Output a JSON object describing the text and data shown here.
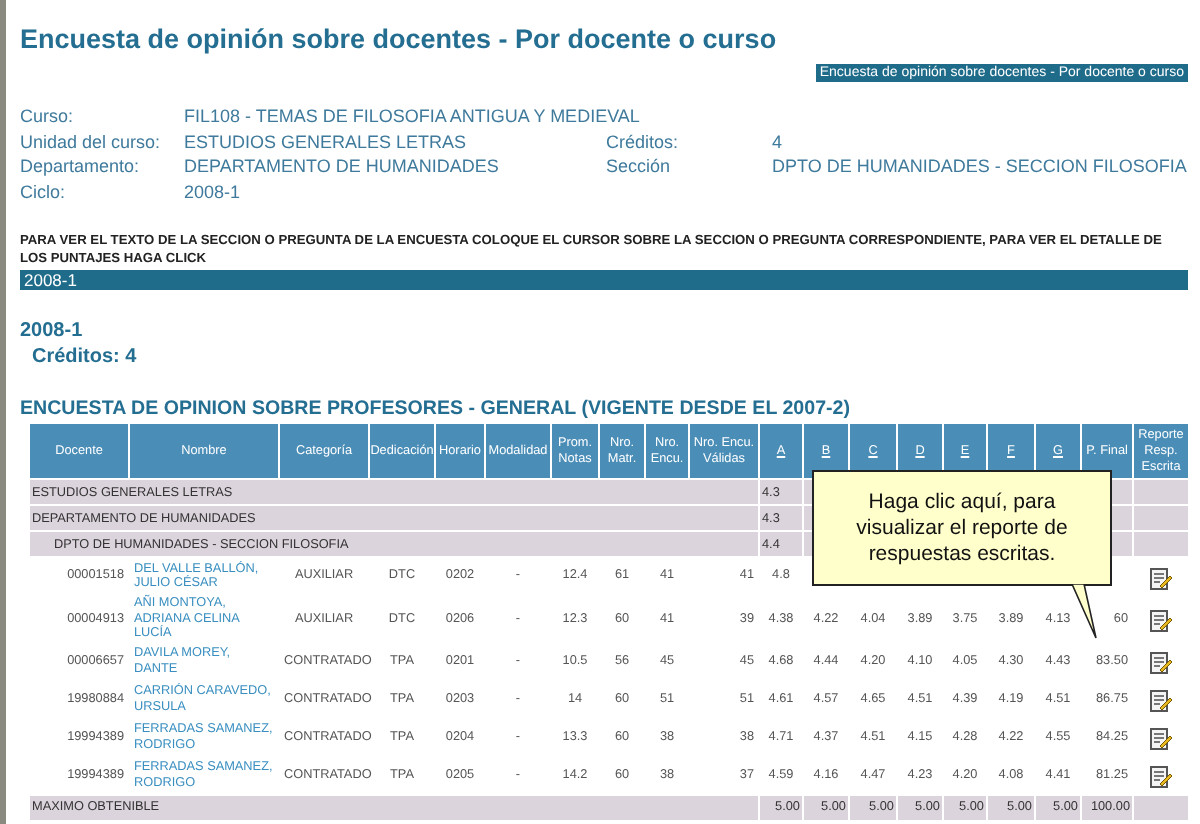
{
  "title": "Encuesta de opinión sobre docentes - Por docente o curso",
  "banner": "Encuesta de opinión sobre docentes - Por docente o curso",
  "info": [
    {
      "label": "Curso:",
      "value": "FIL108 - TEMAS DE FILOSOFIA ANTIGUA Y MEDIEVAL"
    },
    {
      "label": "Unidad del curso:",
      "value": "ESTUDIOS GENERALES LETRAS",
      "label2": "Créditos:",
      "value2": "4"
    },
    {
      "label": "Departamento:",
      "value": "DEPARTAMENTO DE HUMANIDADES",
      "label2": "Sección",
      "value2": "DPTO DE HUMANIDADES - SECCION FILOSOFIA"
    },
    {
      "label": "Ciclo:",
      "value": "2008-1"
    }
  ],
  "instructions": "PARA VER EL TEXTO DE LA SECCION O PREGUNTA DE LA ENCUESTA COLOQUE EL CURSOR SOBRE LA SECCION O PREGUNTA CORRESPONDIENTE, PARA VER EL DETALLE DE LOS PUNTAJES HAGA CLICK",
  "period_bar": "2008-1",
  "period": "2008-1",
  "credits": "Créditos: 4",
  "survey_title": "ENCUESTA DE OPINION SOBRE PROFESORES - GENERAL (VIGENTE DESDE EL 2007-2)",
  "table": {
    "columns": [
      {
        "label": "Docente",
        "link": false
      },
      {
        "label": "Nombre",
        "link": false
      },
      {
        "label": "Categoría",
        "link": false
      },
      {
        "label": "Dedicación",
        "link": false
      },
      {
        "label": "Horario",
        "link": false
      },
      {
        "label": "Modalidad",
        "link": false
      },
      {
        "label": "Prom. Notas",
        "link": false
      },
      {
        "label": "Nro. Matr.",
        "link": false
      },
      {
        "label": "Nro. Encu.",
        "link": false
      },
      {
        "label": "Nro. Encu. Válidas",
        "link": false
      },
      {
        "label": "A",
        "link": true
      },
      {
        "label": "B",
        "link": true
      },
      {
        "label": "C",
        "link": true
      },
      {
        "label": "D",
        "link": true
      },
      {
        "label": "E",
        "link": true
      },
      {
        "label": "F",
        "link": true
      },
      {
        "label": "G",
        "link": true
      },
      {
        "label": "P. Final",
        "link": false
      },
      {
        "label": "Reporte Resp. Escrita",
        "link": false
      }
    ],
    "group_rows": [
      {
        "kind": "unit",
        "label": "ESTUDIOS GENERALES LETRAS",
        "a": "4.3"
      },
      {
        "kind": "unit",
        "label": "DEPARTAMENTO DE HUMANIDADES",
        "a": "4.3"
      },
      {
        "kind": "section",
        "label": "DPTO DE HUMANIDADES - SECCION FILOSOFIA",
        "a": "4.4"
      }
    ],
    "rows": [
      {
        "docente": "00001518",
        "nombre": "DEL VALLE BALLÓN, JULIO CÉSAR",
        "categoria": "AUXILIAR",
        "dedicacion": "DTC",
        "horario": "0202",
        "modalidad": "-",
        "prom": "12.4",
        "matr": "61",
        "encu": "41",
        "validas": "41",
        "scores": [
          "4.8"
        ]
      },
      {
        "docente": "00004913",
        "nombre": "AÑI MONTOYA, ADRIANA CELINA LUCÍA",
        "categoria": "AUXILIAR",
        "dedicacion": "DTC",
        "horario": "0206",
        "modalidad": "-",
        "prom": "12.3",
        "matr": "60",
        "encu": "41",
        "validas": "39",
        "scores": [
          "4.38",
          "4.22",
          "4.04",
          "3.89",
          "3.75",
          "3.89",
          "4.13"
        ],
        "final": "60"
      },
      {
        "docente": "00006657",
        "nombre": "DAVILA MOREY, DANTE",
        "categoria": "CONTRATADO",
        "dedicacion": "TPA",
        "horario": "0201",
        "modalidad": "-",
        "prom": "10.5",
        "matr": "56",
        "encu": "45",
        "validas": "45",
        "scores": [
          "4.68",
          "4.44",
          "4.20",
          "4.10",
          "4.05",
          "4.30",
          "4.43"
        ],
        "final": "83.50"
      },
      {
        "docente": "19980884",
        "nombre": "CARRIÓN CARAVEDO, URSULA",
        "categoria": "CONTRATADO",
        "dedicacion": "TPA",
        "horario": "0203",
        "modalidad": "-",
        "prom": "14",
        "matr": "60",
        "encu": "51",
        "validas": "51",
        "scores": [
          "4.61",
          "4.57",
          "4.65",
          "4.51",
          "4.39",
          "4.19",
          "4.51"
        ],
        "final": "86.75"
      },
      {
        "docente": "19994389",
        "nombre": "FERRADAS SAMANEZ, RODRIGO",
        "categoria": "CONTRATADO",
        "dedicacion": "TPA",
        "horario": "0204",
        "modalidad": "-",
        "prom": "13.3",
        "matr": "60",
        "encu": "38",
        "validas": "38",
        "scores": [
          "4.71",
          "4.37",
          "4.51",
          "4.15",
          "4.28",
          "4.22",
          "4.55"
        ],
        "final": "84.25"
      },
      {
        "docente": "19994389",
        "nombre": "FERRADAS SAMANEZ, RODRIGO",
        "categoria": "CONTRATADO",
        "dedicacion": "TPA",
        "horario": "0205",
        "modalidad": "-",
        "prom": "14.2",
        "matr": "60",
        "encu": "38",
        "validas": "37",
        "scores": [
          "4.59",
          "4.16",
          "4.47",
          "4.23",
          "4.20",
          "4.08",
          "4.41"
        ],
        "final": "81.25"
      }
    ],
    "max_row": {
      "label": "MAXIMO OBTENIBLE",
      "scores": [
        "5.00",
        "5.00",
        "5.00",
        "5.00",
        "5.00",
        "5.00",
        "5.00"
      ],
      "final": "100.00"
    }
  },
  "tooltip": {
    "text": "Haga clic aquí, para visualizar el reporte de respuestas escritas."
  }
}
